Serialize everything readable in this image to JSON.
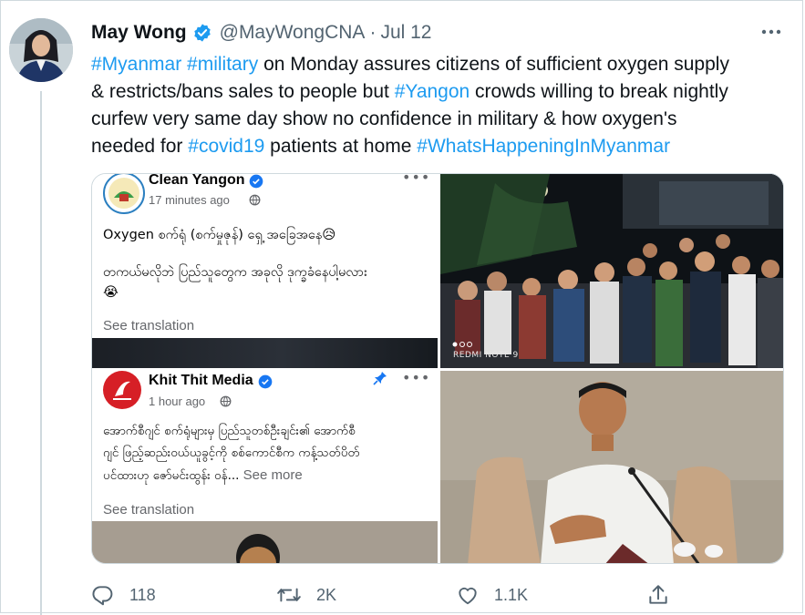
{
  "tweet": {
    "author_name": "May Wong",
    "handle": "@MayWongCNA",
    "separator": "·",
    "date": "Jul 12",
    "lines": [
      [
        {
          "t": "#Myanmar",
          "tag": true
        },
        {
          "t": " "
        },
        {
          "t": "#military",
          "tag": true
        },
        {
          "t": " on Monday assures citizens of sufficient oxygen supply"
        }
      ],
      [
        {
          "t": "& restricts/bans sales to people but "
        },
        {
          "t": "#Yangon",
          "tag": true
        },
        {
          "t": " crowds willing to break nightly"
        }
      ],
      [
        {
          "t": "curfew very same day show no confidence in military & how oxygen's"
        }
      ],
      [
        {
          "t": "needed for "
        },
        {
          "t": "#covid19",
          "tag": true
        },
        {
          "t": " patients at home "
        },
        {
          "t": "#WhatsHappeningInMyanmar",
          "tag": true
        }
      ]
    ]
  },
  "media": {
    "post1": {
      "page_name": "Clean Yangon",
      "time": "17 minutes ago",
      "line1": "Oxygen စက်ရုံ (စက်မှုဇုန်) ရှေ့ အခြေအနေ😥",
      "line2": "တကယ်မလိုဘဲ ပြည်သူတွေက အခုလို ဒုက္ခခံနေပါ့မလား",
      "emoji2": "😭",
      "see_translation": "See translation"
    },
    "photo1": {
      "watermark": "REDMI NOTE 9"
    },
    "post2": {
      "page_name": "Khit Thit Media",
      "time": "1 hour ago",
      "line1": "အောက်စီဂျင် စက်ရုံများမှ ပြည်သူတစ်ဦးချင်း၏ အောက်စီ",
      "line2": "ဂျင် ဖြည့်ဆည်းဝယ်ယူခွင့်ကို စစ်ကောင်စီက ကန့်သတ်ပိတ်",
      "line3": "ပင်ထားဟု ဇော်မင်းထွန်း ဝန်...",
      "see_more": " See more",
      "see_translation": "See translation"
    }
  },
  "actions": {
    "reply_count": "118",
    "retweet_count": "2K",
    "like_count": "1.1K"
  },
  "colors": {
    "link": "#1d9bf0",
    "verified": "#1d9bf0",
    "muted": "#536471"
  }
}
